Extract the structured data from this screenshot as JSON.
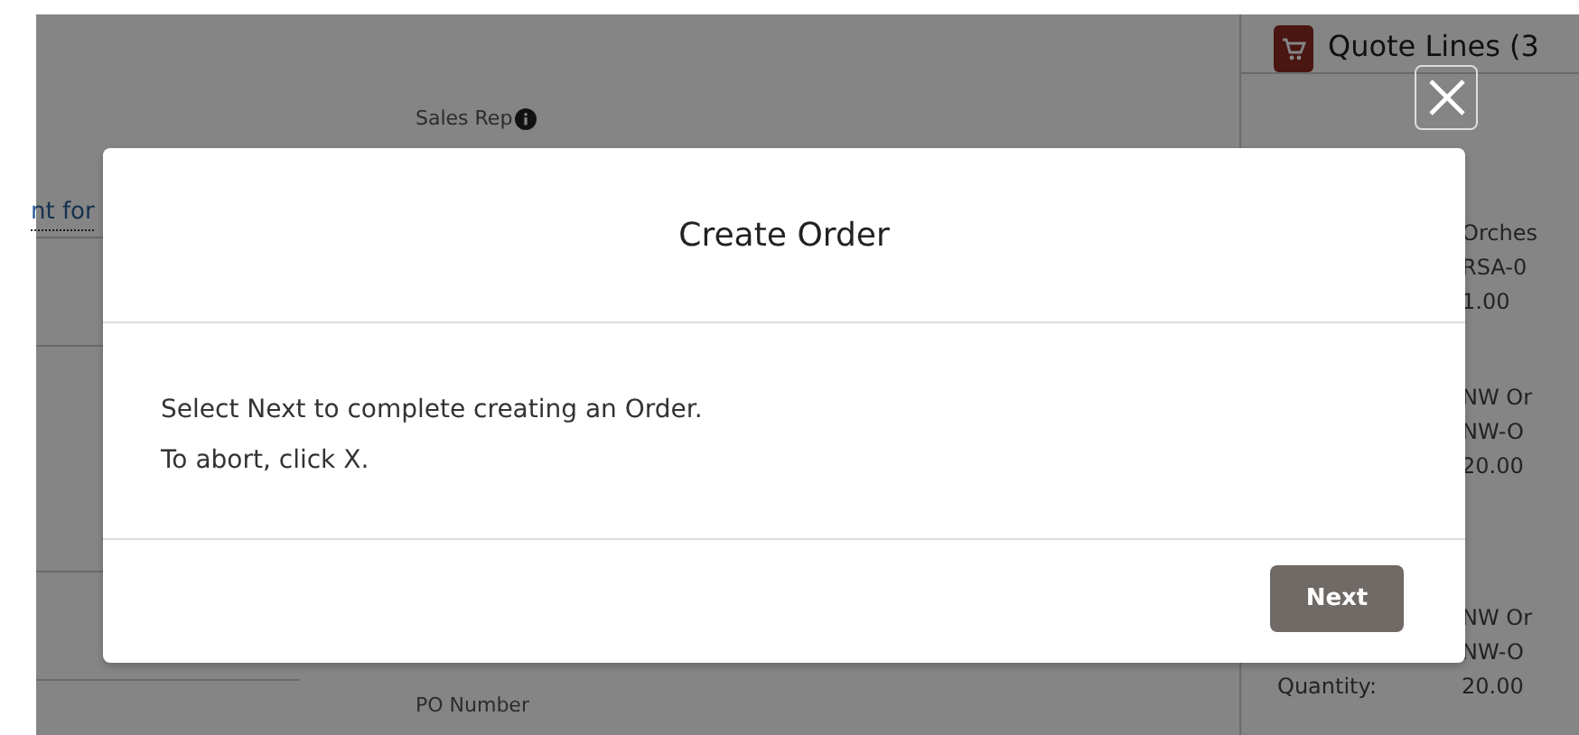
{
  "background": {
    "left_link": "nt for",
    "sales_rep_label": "Sales Rep",
    "po_number_label": "PO Number",
    "quote_lines": {
      "title": "Quote Lines (3",
      "items": [
        {
          "rows": [
            {
              "value": "Orches"
            },
            {
              "value": "RSA-0"
            },
            {
              "value": "1.00"
            }
          ]
        },
        {
          "rows": [
            {
              "value": "NW Or"
            },
            {
              "value": "NW-O"
            },
            {
              "value": "20.00"
            }
          ]
        },
        {
          "rows": [
            {
              "value": "NW Or"
            },
            {
              "value": "NW-O"
            },
            {
              "label": "Quantity:",
              "value": "20.00"
            }
          ]
        }
      ]
    }
  },
  "dialog": {
    "title": "Create Order",
    "message_lines": [
      "Select Next to complete creating an Order.",
      "To abort, click X."
    ],
    "buttons": [
      "Next"
    ]
  }
}
